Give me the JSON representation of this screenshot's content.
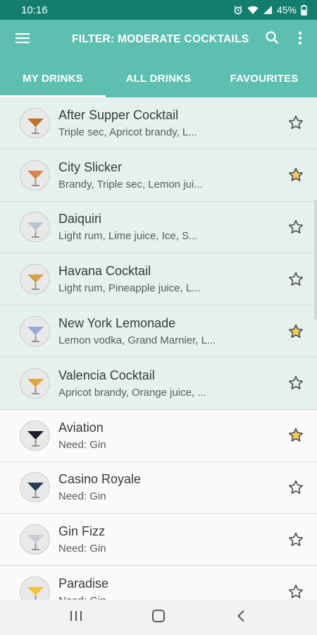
{
  "status_bar": {
    "time": "10:16",
    "battery": "45%"
  },
  "app_bar": {
    "title": "FILTER: MODERATE COCKTAILS"
  },
  "tabs": [
    {
      "label": "MY DRINKS",
      "selected": true
    },
    {
      "label": "ALL DRINKS",
      "selected": false
    },
    {
      "label": "FAVOURITES",
      "selected": false
    }
  ],
  "drinks": [
    {
      "name": "After Supper Cocktail",
      "subtitle": "Triple sec, Apricot brandy, L...",
      "favourite": false,
      "available": true,
      "thumb_color": "#b8742a"
    },
    {
      "name": "City Slicker",
      "subtitle": "Brandy, Triple sec, Lemon jui...",
      "favourite": true,
      "available": true,
      "thumb_color": "#d9824a"
    },
    {
      "name": "Daiquiri",
      "subtitle": "Light rum, Lime juice, Ice, S...",
      "favourite": false,
      "available": true,
      "thumb_color": "#b9c4cf"
    },
    {
      "name": "Havana Cocktail",
      "subtitle": "Light rum, Pineapple juice, L...",
      "favourite": false,
      "available": true,
      "thumb_color": "#d8a04c"
    },
    {
      "name": "New York Lemonade",
      "subtitle": "Lemon vodka, Grand Marnier, L...",
      "favourite": true,
      "available": true,
      "thumb_color": "#9aa7d6"
    },
    {
      "name": "Valencia Cocktail",
      "subtitle": "Apricot brandy, Orange juice, ...",
      "favourite": false,
      "available": true,
      "thumb_color": "#e0a83b"
    },
    {
      "name": "Aviation",
      "subtitle": "Need: Gin",
      "favourite": true,
      "available": false,
      "thumb_color": "#1a2030"
    },
    {
      "name": "Casino Royale",
      "subtitle": "Need: Gin",
      "favourite": false,
      "available": false,
      "thumb_color": "#2b3a55"
    },
    {
      "name": "Gin Fizz",
      "subtitle": "Need: Gin",
      "favourite": false,
      "available": false,
      "thumb_color": "#c9cdd0"
    },
    {
      "name": "Paradise",
      "subtitle": "Need: Gin",
      "favourite": false,
      "available": false,
      "thumb_color": "#f2c23a"
    }
  ],
  "colors": {
    "status_bar": "#137e6e",
    "primary": "#5cbfb0",
    "owned_row": "#e4f1ef",
    "star_favourite": "#f2cc5b"
  }
}
